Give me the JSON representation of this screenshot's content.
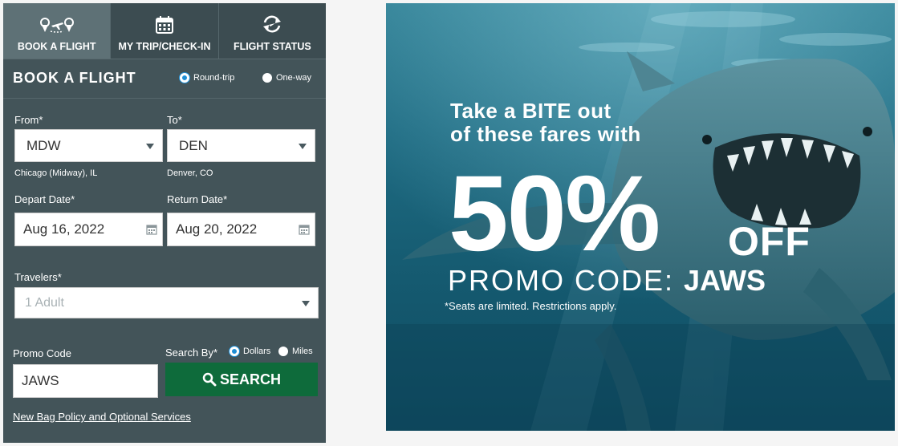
{
  "tabs": [
    {
      "label": "BOOK A FLIGHT",
      "icon": "plane-pin-icon",
      "active": true
    },
    {
      "label": "MY TRIP/CHECK-IN",
      "icon": "calendar-icon",
      "active": false
    },
    {
      "label": "FLIGHT STATUS",
      "icon": "refresh-icon",
      "active": false
    }
  ],
  "booking": {
    "title": "BOOK A FLIGHT",
    "trip_types": [
      {
        "label": "Round-trip",
        "selected": true
      },
      {
        "label": "One-way",
        "selected": false
      }
    ],
    "from": {
      "label": "From*",
      "value": "MDW",
      "city": "Chicago (Midway), IL"
    },
    "to": {
      "label": "To*",
      "value": "DEN",
      "city": "Denver, CO"
    },
    "depart": {
      "label": "Depart Date*",
      "value": "Aug 16, 2022"
    },
    "return": {
      "label": "Return Date*",
      "value": "Aug 20, 2022"
    },
    "travelers": {
      "label": "Travelers*",
      "placeholder": "1 Adult"
    },
    "promo": {
      "label": "Promo Code",
      "value": "JAWS"
    },
    "search_by": {
      "label": "Search By*",
      "options": [
        {
          "label": "Dollars",
          "selected": true
        },
        {
          "label": "Miles",
          "selected": false
        }
      ]
    },
    "search_label": "SEARCH",
    "bag_link": "New Bag Policy and Optional Services"
  },
  "promo_banner": {
    "line1": "Take a BITE out",
    "line2": "of these fares with",
    "percent": "50%",
    "off": "OFF",
    "code_prefix": "PROMO CODE: ",
    "code": "JAWS",
    "disclaimer": "*Seats are limited. Restrictions apply."
  },
  "colors": {
    "widget_bg": "#435459",
    "active_tab": "#5e7176",
    "search_button": "#0e6b3b",
    "radio_selected": "#1e8fd6",
    "banner_water": "#1f6c83"
  }
}
